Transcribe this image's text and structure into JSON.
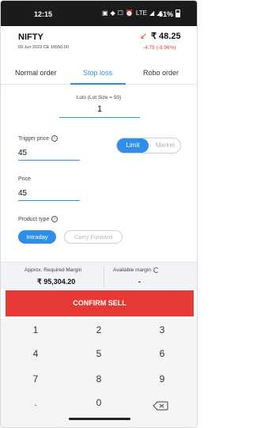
{
  "status_bar": {
    "time": "12:15",
    "icons_text": [
      "▣",
      "◆",
      "☐",
      "⏰",
      "LTE",
      "◢",
      "◢"
    ],
    "battery_percent": "51%"
  },
  "instrument": {
    "symbol": "NIFTY",
    "contract": "09 Jun 2022 CE 16550.00",
    "ltp": "₹ 48.25",
    "change": "-4.75 (-8.96%)",
    "direction_icon": "arrow-down-left-icon"
  },
  "tabs": [
    {
      "label": "Normal order",
      "active": false
    },
    {
      "label": "Stop loss",
      "active": true
    },
    {
      "label": "Robo order",
      "active": false
    }
  ],
  "lots": {
    "label": "Lots (Lot Size = 50)",
    "value": "1"
  },
  "trigger_price": {
    "label": "Trigger price",
    "value": "45"
  },
  "order_type": {
    "options": [
      "Limit",
      "Market"
    ],
    "selected": "Limit"
  },
  "price": {
    "label": "Price",
    "value": "45"
  },
  "product_type": {
    "label": "Product type",
    "options": [
      "Intraday",
      "Carry Forward"
    ],
    "selected": "Intraday"
  },
  "margin": {
    "required_label": "Approx. Required Margin",
    "required_value": "₹ 95,304.20",
    "available_label": "Available margin",
    "available_value": "-"
  },
  "confirm_label": "CONFIRM SELL",
  "keypad": {
    "keys": [
      "1",
      "2",
      "3",
      "4",
      "5",
      "6",
      "7",
      "8",
      "9",
      ".",
      "0"
    ],
    "backspace_icon": "backspace-icon"
  },
  "colors": {
    "accent": "#2f8fe6",
    "sell": "#e53935"
  }
}
